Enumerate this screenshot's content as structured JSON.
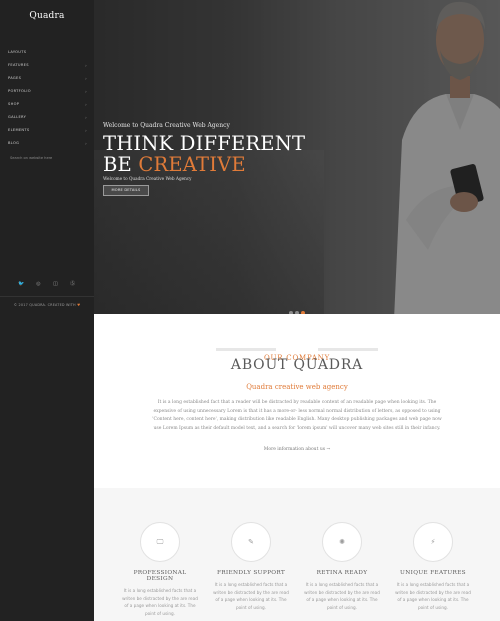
{
  "sidebar": {
    "logo": "Quadra",
    "menu": [
      {
        "label": "LAYOUTS",
        "has_children": false
      },
      {
        "label": "FEATURES",
        "has_children": true
      },
      {
        "label": "PAGES",
        "has_children": true
      },
      {
        "label": "PORTFOLIO",
        "has_children": true
      },
      {
        "label": "SHOP",
        "has_children": true
      },
      {
        "label": "GALLERY",
        "has_children": true
      },
      {
        "label": "ELEMENTS",
        "has_children": true
      },
      {
        "label": "BLOG",
        "has_children": true
      }
    ],
    "search_placeholder": "Search on website here",
    "socials": [
      {
        "name": "twitter-icon",
        "glyph": "🐦"
      },
      {
        "name": "dribbble-icon",
        "glyph": "◎"
      },
      {
        "name": "instagram-icon",
        "glyph": "◫"
      },
      {
        "name": "skype-icon",
        "glyph": "Ⓢ"
      }
    ],
    "copyright": "© 2017 QUADRA. CREATED WITH",
    "heart": "♥"
  },
  "hero": {
    "welcome": "Welcome to Quadra Creative Web Agency",
    "headline_line1": "THINK DIFFERENT",
    "headline_line2_prefix": "BE ",
    "headline_line2_accent": "CREATIVE",
    "subtext": "Welcome to Quadra Creative Web Agency",
    "button_label": "MORE DETAILS",
    "slides": 3,
    "active_slide": 3
  },
  "about": {
    "eyebrow": "OUR COMPANY",
    "title": "ABOUT QUADRA",
    "subtitle": "Quadra creative web agency",
    "body": "It is a long established fact that a reader will be distracted by readable content of an readable page when looking its. The expensive of using unnecessary Lorem is that it has a more-or- less normal normal distribution of letters, as opposed to using 'Content here, content here', making distribution like readable English. Many desktop publishing packages and web page now use Lorem Ipsum as their default model text, and a search for 'lorem ipsum' will uncover many web sites still in their infancy.",
    "more_link": "More information about us →"
  },
  "features": [
    {
      "icon": "monitor-icon",
      "glyph": "🖵",
      "title": "PROFESSIONAL DESIGN",
      "text": "It is a long established facts that a writen be distracted by the are read of a page when looking at its. The point of using."
    },
    {
      "icon": "feather-icon",
      "glyph": "✎",
      "title": "FRIENDLY SUPPORT",
      "text": "It is a long established facts that a writen be distracted by the are read of a page when looking at its. The point of using."
    },
    {
      "icon": "sun-icon",
      "glyph": "✺",
      "title": "RETINA READY",
      "text": "It is a long established facts that a writen be distracted by the are read of a page when looking at its. The point of using."
    },
    {
      "icon": "lightning-icon",
      "glyph": "⚡",
      "title": "UNIQUE FEATURES",
      "text": "It is a long established facts that a writen be distracted by the are read of a page when looking at its. The point of using."
    }
  ],
  "colors": {
    "accent": "#e07b39",
    "sidebar_bg": "#222222",
    "features_bg": "#f6f6f6"
  }
}
